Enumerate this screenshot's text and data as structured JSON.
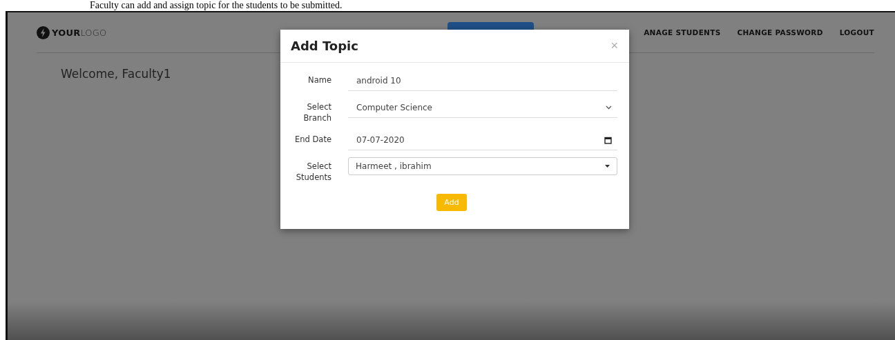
{
  "caption": "Faculty can add and assign topic for the students to be submitted.",
  "logo": {
    "bold": "YOUR",
    "light": "LOGO"
  },
  "nav": [
    "ANAGE STUDENTS",
    "CHANGE PASSWORD",
    "LOGOUT"
  ],
  "welcome": "Welcome, Faculty1",
  "modal": {
    "title": "Add Topic",
    "close": "×",
    "fields": [
      {
        "kind": "text",
        "label": "Name",
        "value": "android 10"
      },
      {
        "kind": "select",
        "label": "Select Branch",
        "value": "Computer Science"
      },
      {
        "kind": "date",
        "label": "End Date",
        "value": "07-07-2020"
      },
      {
        "kind": "multiselect",
        "label": "Select Students",
        "value": "Harmeet , ibrahim"
      }
    ],
    "submit": "Add"
  }
}
